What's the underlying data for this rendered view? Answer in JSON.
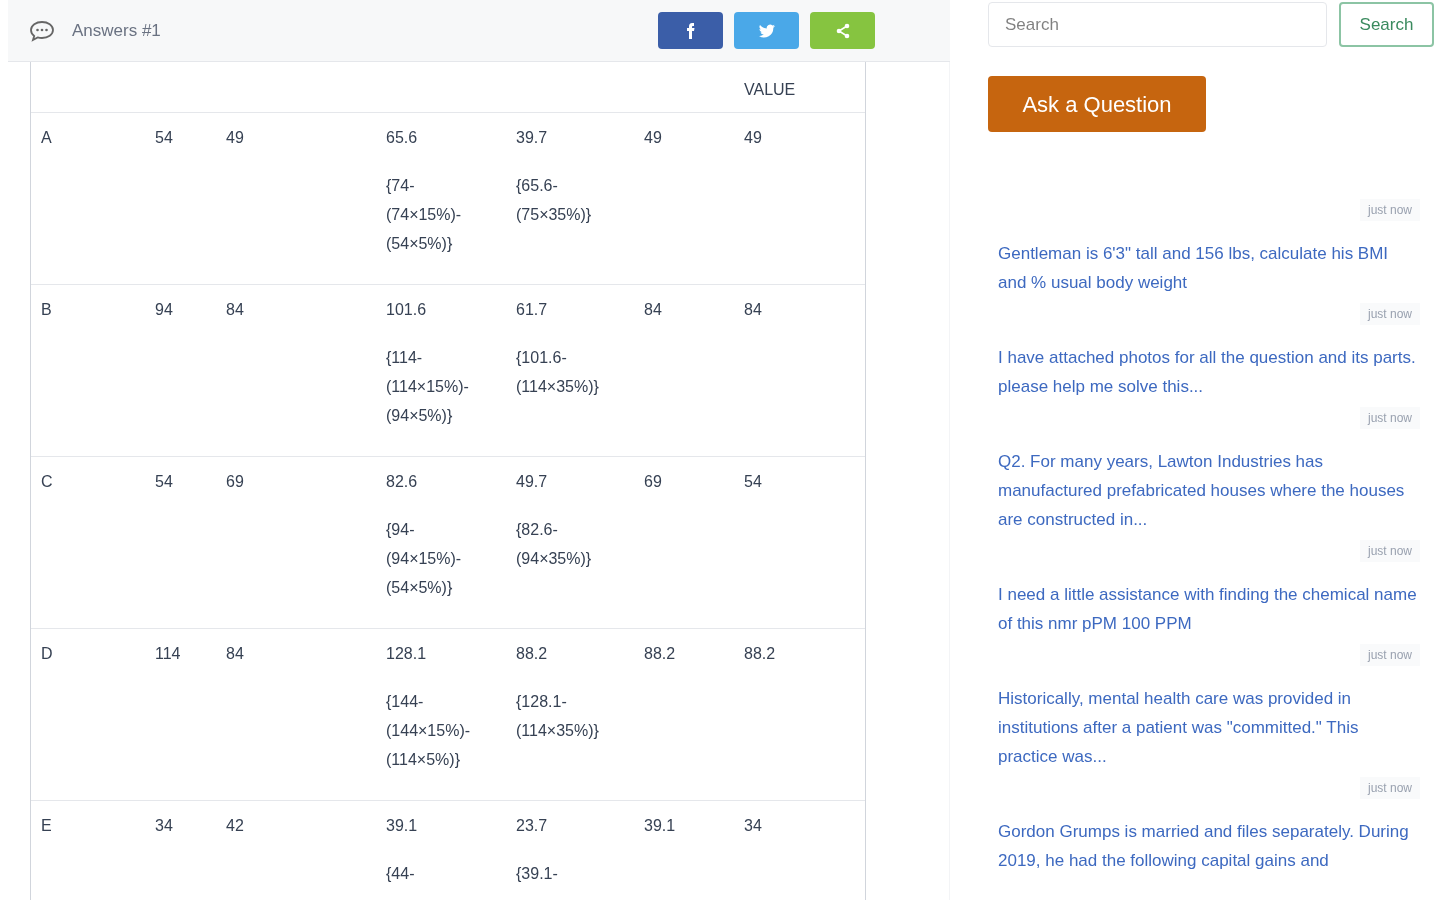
{
  "header": {
    "title": "Answers #1",
    "share_buttons": [
      {
        "kind": "facebook"
      },
      {
        "kind": "twitter"
      },
      {
        "kind": "share"
      }
    ]
  },
  "table": {
    "columns": [
      "",
      "",
      "",
      "",
      "",
      "",
      "VALUE"
    ],
    "rows": [
      {
        "cells": [
          {
            "value": "A"
          },
          {
            "value": "54"
          },
          {
            "value": "49"
          },
          {
            "value": "65.6",
            "formula_lines": [
              "{74-",
              "(74×15%)-",
              "(54×5%)}"
            ]
          },
          {
            "value": "39.7",
            "formula_lines": [
              "{65.6-",
              "(75×35%)}"
            ]
          },
          {
            "value": "49"
          },
          {
            "value": "49"
          }
        ]
      },
      {
        "cells": [
          {
            "value": "B"
          },
          {
            "value": "94"
          },
          {
            "value": "84"
          },
          {
            "value": "101.6",
            "formula_lines": [
              "{114-",
              "(114×15%)-",
              "(94×5%)}"
            ]
          },
          {
            "value": "61.7",
            "formula_lines": [
              "{101.6-",
              "(114×35%)}"
            ]
          },
          {
            "value": "84"
          },
          {
            "value": "84"
          }
        ]
      },
      {
        "cells": [
          {
            "value": "C"
          },
          {
            "value": "54"
          },
          {
            "value": "69"
          },
          {
            "value": "82.6",
            "formula_lines": [
              "{94-",
              "(94×15%)-",
              "(54×5%)}"
            ]
          },
          {
            "value": "49.7",
            "formula_lines": [
              "{82.6-",
              "(94×35%)}"
            ]
          },
          {
            "value": "69"
          },
          {
            "value": "54"
          }
        ]
      },
      {
        "cells": [
          {
            "value": "D"
          },
          {
            "value": "114"
          },
          {
            "value": "84"
          },
          {
            "value": "128.1",
            "formula_lines": [
              "{144-",
              "(144×15%)-",
              "(114×5%)}"
            ]
          },
          {
            "value": "88.2",
            "formula_lines": [
              "{128.1-",
              "(114×35%)}"
            ]
          },
          {
            "value": "88.2"
          },
          {
            "value": "88.2"
          }
        ]
      },
      {
        "cells": [
          {
            "value": "E"
          },
          {
            "value": "34"
          },
          {
            "value": "42"
          },
          {
            "value": "39.1",
            "formula_lines": [
              "{44-"
            ]
          },
          {
            "value": "23.7",
            "formula_lines": [
              "{39.1-"
            ]
          },
          {
            "value": "39.1"
          },
          {
            "value": "34"
          }
        ]
      }
    ]
  },
  "sidebar": {
    "search": {
      "placeholder": "Search",
      "button": "Search"
    },
    "ask_button": "Ask a Question",
    "feed": [
      {
        "kind": "time",
        "text": "just now"
      },
      {
        "kind": "question",
        "text": "Gentleman is 6'3\" tall and 156 lbs, calculate his BMI and % usual body weight"
      },
      {
        "kind": "time",
        "text": "just now"
      },
      {
        "kind": "question",
        "text": "I have attached photos for all the question and its parts. please help me solve this..."
      },
      {
        "kind": "time",
        "text": "just now"
      },
      {
        "kind": "question",
        "text": "Q2. For many years, Lawton Industries has manufactured prefabricated houses where the houses are constructed in..."
      },
      {
        "kind": "time",
        "text": "just now"
      },
      {
        "kind": "question",
        "text": "I need a little assistance with finding the chemical name of this nmr pPM 100 PPM"
      },
      {
        "kind": "time",
        "text": "just now"
      },
      {
        "kind": "question",
        "text": "Historically, mental health care was provided in institutions after a patient was \"committed.\" This practice was..."
      },
      {
        "kind": "time",
        "text": "just now"
      },
      {
        "kind": "question",
        "text": "Gordon Grumps is married and files separately. During 2019, he had the following capital gains and"
      }
    ]
  }
}
